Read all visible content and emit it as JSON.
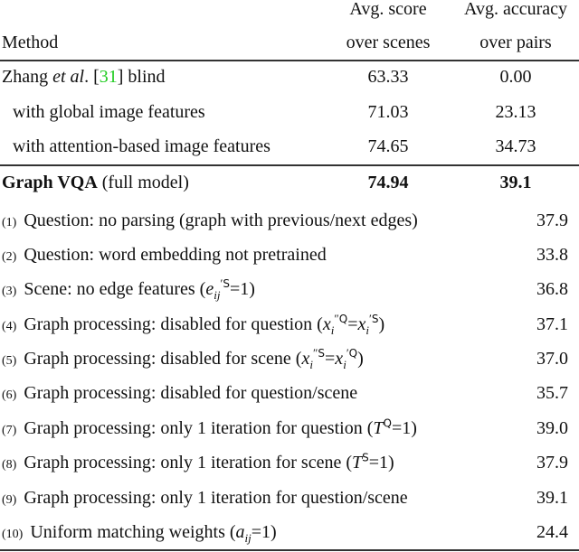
{
  "header": {
    "method": "Method",
    "col2_line1": "Avg. score",
    "col2_line2": "over scenes",
    "col3_line1": "Avg. accuracy",
    "col3_line2": "over pairs"
  },
  "baselines": [
    {
      "pre": "Zhang ",
      "ital": "et al",
      "post_dot": ". [",
      "cite": "31",
      "post": "] blind",
      "score": "63.33",
      "acc": "0.00"
    },
    {
      "label": "with global image features",
      "score": "71.03",
      "acc": "23.13"
    },
    {
      "label": "with attention-based image features",
      "score": "74.65",
      "acc": "34.73"
    }
  ],
  "full_model": {
    "bold": "Graph VQA",
    "rest": " (full model)",
    "score": "74.94",
    "acc": "39.1"
  },
  "ablations": [
    {
      "num": "(1)",
      "text": "Question: no parsing (graph with previous/next edges)",
      "acc": "37.9"
    },
    {
      "num": "(2)",
      "text": "Question: word embedding not pretrained",
      "acc": "33.8"
    },
    {
      "num": "(3)",
      "text": "Scene: no edge features (",
      "acc": "36.8"
    },
    {
      "num": "(4)",
      "text": "Graph processing: disabled for question (",
      "acc": "37.1"
    },
    {
      "num": "(5)",
      "text": "Graph processing: disabled for scene (",
      "acc": "37.0"
    },
    {
      "num": "(6)",
      "text": "Graph processing: disabled for question/scene",
      "acc": "35.7"
    },
    {
      "num": "(7)",
      "text": "Graph processing: only 1 iteration for question (",
      "acc": "39.0"
    },
    {
      "num": "(8)",
      "text": "Graph processing: only 1 iteration for scene (",
      "acc": "37.9"
    },
    {
      "num": "(9)",
      "text": "Graph processing: only 1 iteration for question/scene",
      "acc": "39.1"
    },
    {
      "num": "(10)",
      "text": "Uniform matching weights (",
      "acc": "24.4"
    }
  ],
  "colors": {
    "citation": "#22cc22",
    "rule": "#333333"
  }
}
